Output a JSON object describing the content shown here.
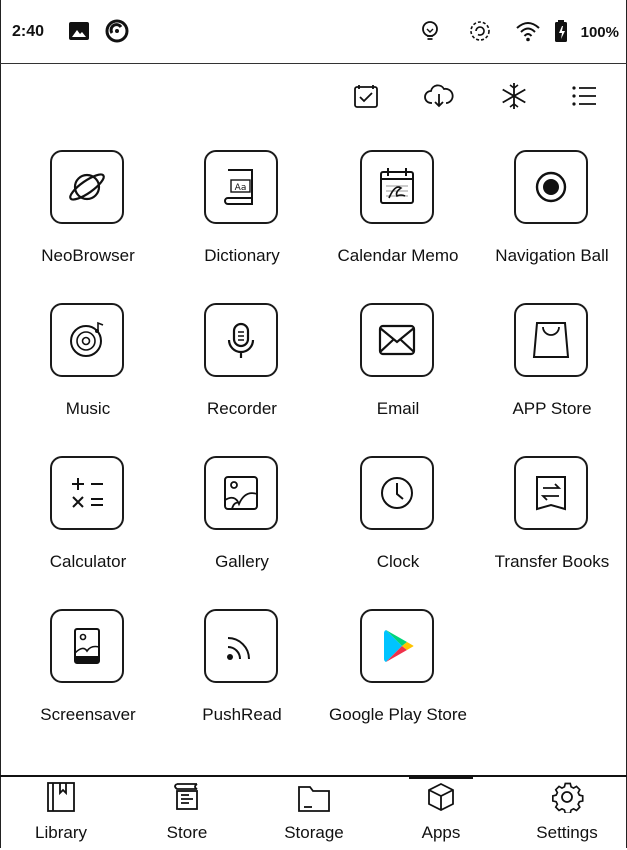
{
  "status_bar": {
    "time": "2:40",
    "battery_percent": "100%",
    "left_icons": [
      "image-icon",
      "sync-badge-icon"
    ],
    "right_icons": [
      "bulb-icon",
      "refresh-icon",
      "wifi-icon",
      "battery-icon"
    ]
  },
  "toolbar": {
    "icons": [
      "checklist-icon",
      "cloud-download-icon",
      "snowflake-icon",
      "list-menu-icon"
    ]
  },
  "apps": [
    {
      "label": "NeoBrowser",
      "icon": "planet-icon"
    },
    {
      "label": "Dictionary",
      "icon": "dictionary-icon"
    },
    {
      "label": "Calendar Memo",
      "icon": "calendar-memo-icon"
    },
    {
      "label": "Navigation Ball",
      "icon": "navigation-ball-icon"
    },
    {
      "label": "Music",
      "icon": "music-disc-icon"
    },
    {
      "label": "Recorder",
      "icon": "microphone-icon"
    },
    {
      "label": "Email",
      "icon": "envelope-icon"
    },
    {
      "label": "APP Store",
      "icon": "shopping-bag-icon"
    },
    {
      "label": "Calculator",
      "icon": "calculator-icon"
    },
    {
      "label": "Gallery",
      "icon": "gallery-icon"
    },
    {
      "label": "Clock",
      "icon": "clock-icon"
    },
    {
      "label": "Transfer Books",
      "icon": "transfer-books-icon"
    },
    {
      "label": "Screensaver",
      "icon": "screensaver-icon"
    },
    {
      "label": "PushRead",
      "icon": "rss-icon"
    },
    {
      "label": "Google Play Store",
      "icon": "play-store-icon"
    }
  ],
  "bottom_nav": {
    "active": "Apps",
    "items": [
      {
        "label": "Library",
        "icon": "library-icon"
      },
      {
        "label": "Store",
        "icon": "store-icon"
      },
      {
        "label": "Storage",
        "icon": "folder-icon"
      },
      {
        "label": "Apps",
        "icon": "cube-icon"
      },
      {
        "label": "Settings",
        "icon": "gear-icon"
      }
    ]
  }
}
